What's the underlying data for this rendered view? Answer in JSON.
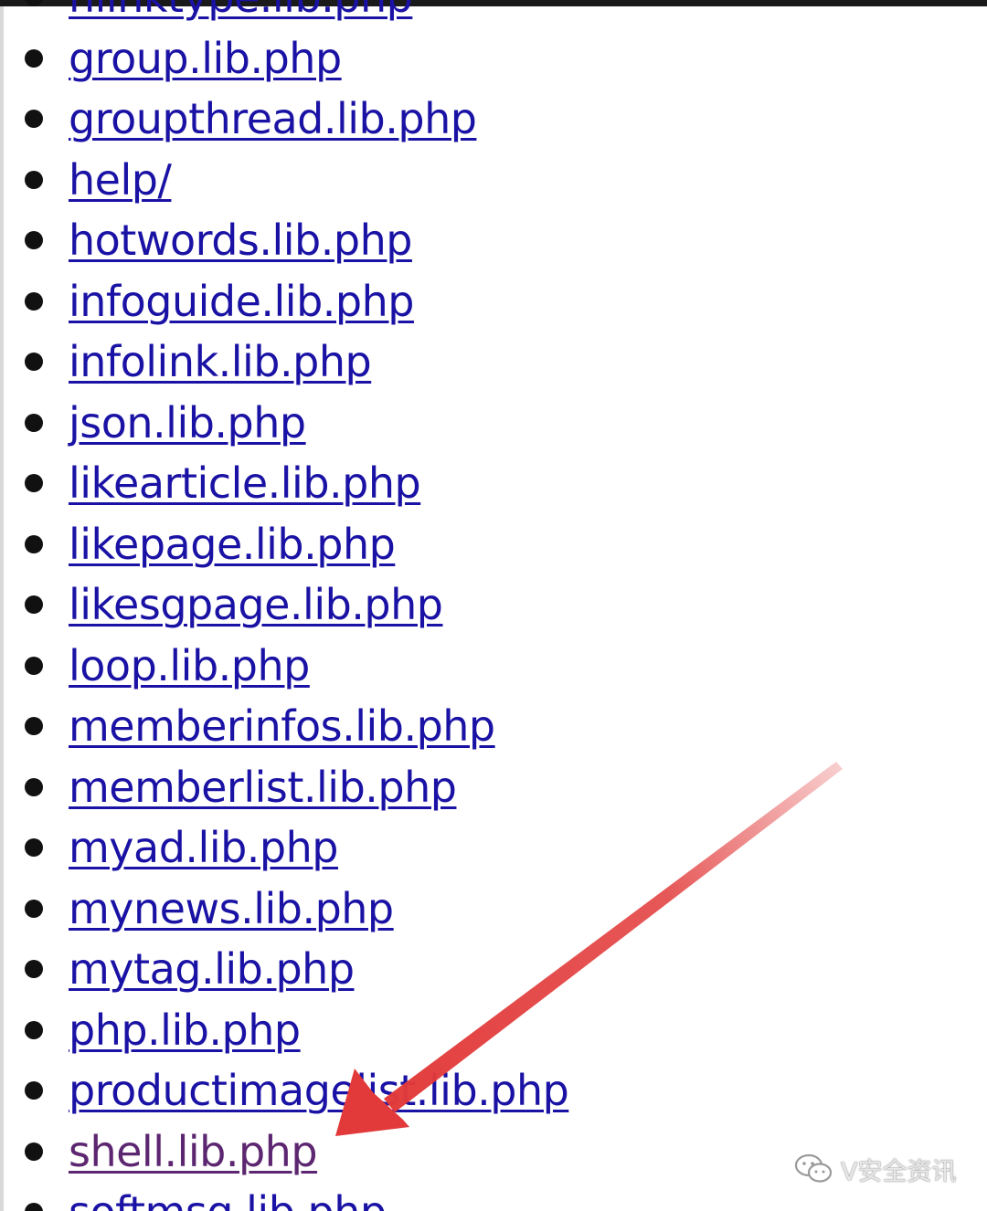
{
  "files": [
    {
      "name": "hlinktype.lib.php",
      "visited": false
    },
    {
      "name": "group.lib.php",
      "visited": false
    },
    {
      "name": "groupthread.lib.php",
      "visited": false
    },
    {
      "name": "help/",
      "visited": false
    },
    {
      "name": "hotwords.lib.php",
      "visited": false
    },
    {
      "name": "infoguide.lib.php",
      "visited": false
    },
    {
      "name": "infolink.lib.php",
      "visited": false
    },
    {
      "name": "json.lib.php",
      "visited": false
    },
    {
      "name": "likearticle.lib.php",
      "visited": false
    },
    {
      "name": "likepage.lib.php",
      "visited": false
    },
    {
      "name": "likesgpage.lib.php",
      "visited": false
    },
    {
      "name": "loop.lib.php",
      "visited": false
    },
    {
      "name": "memberinfos.lib.php",
      "visited": false
    },
    {
      "name": "memberlist.lib.php",
      "visited": false
    },
    {
      "name": "myad.lib.php",
      "visited": false
    },
    {
      "name": "mynews.lib.php",
      "visited": false
    },
    {
      "name": "mytag.lib.php",
      "visited": false
    },
    {
      "name": "php.lib.php",
      "visited": false
    },
    {
      "name": "productimagelist.lib.php",
      "visited": false
    },
    {
      "name": "shell.lib.php",
      "visited": true
    },
    {
      "name": "softmsg.lib.php",
      "visited": false
    }
  ],
  "colors": {
    "link": "#1a12a4",
    "visited_link": "#5c2670",
    "arrow": "#e23a3a"
  },
  "watermark": {
    "icon": "wechat-icon",
    "text": "V安全资讯"
  }
}
